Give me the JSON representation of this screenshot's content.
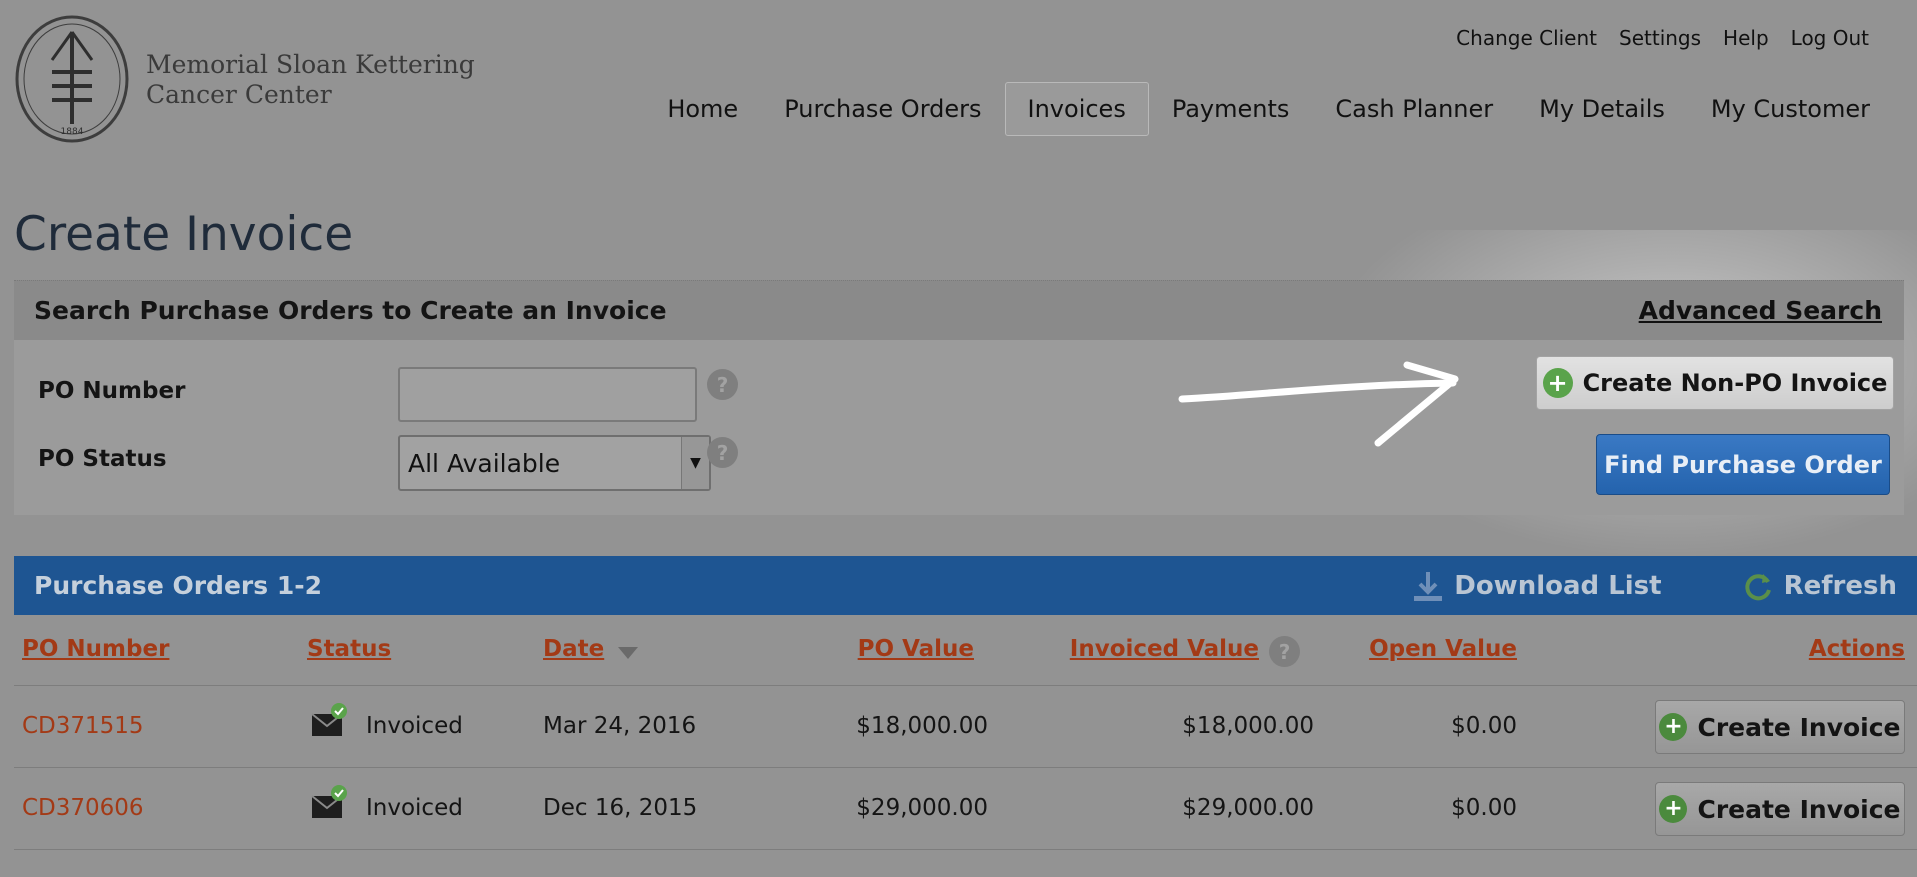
{
  "org": {
    "name_line1": "Memorial Sloan Kettering",
    "name_line2": "Cancer Center",
    "logo_year": "1884"
  },
  "util_nav": [
    "Change Client",
    "Settings",
    "Help",
    "Log Out"
  ],
  "main_nav": {
    "items": [
      "Home",
      "Purchase Orders",
      "Invoices",
      "Payments",
      "Cash Planner",
      "My Details",
      "My Customer"
    ],
    "active": "Invoices"
  },
  "page_title": "Create Invoice",
  "search": {
    "title": "Search Purchase Orders to Create an Invoice",
    "advanced_link": "Advanced Search",
    "po_number_label": "PO Number",
    "po_number_value": "",
    "po_status_label": "PO Status",
    "po_status_selected": "All Available",
    "help_glyph": "?",
    "create_nonpo_label": "Create Non-PO Invoice",
    "find_label": "Find Purchase Order"
  },
  "results": {
    "title": "Purchase Orders 1-2",
    "download_label": "Download List",
    "refresh_label": "Refresh",
    "columns": [
      "PO Number",
      "Status",
      "Date",
      "PO Value",
      "Invoiced Value",
      "Open Value",
      "Actions"
    ],
    "rows": [
      {
        "po_number": "CD371515",
        "status": "Invoiced",
        "date": "Mar 24, 2016",
        "po_value": "$18,000.00",
        "invoiced_value": "$18,000.00",
        "open_value": "$0.00",
        "action": "Create Invoice"
      },
      {
        "po_number": "CD370606",
        "status": "Invoiced",
        "date": "Dec 16, 2015",
        "po_value": "$29,000.00",
        "invoiced_value": "$29,000.00",
        "open_value": "$0.00",
        "action": "Create Invoice"
      }
    ]
  },
  "colors": {
    "accent_blue": "#1e5592",
    "link_red": "#a33a16",
    "plus_green": "#5aa34b"
  },
  "icons": [
    "msk-logo-icon",
    "help-icon",
    "plus-circle-icon",
    "download-icon",
    "refresh-icon",
    "sort-desc-icon",
    "envelope-check-icon",
    "annotation-arrow"
  ]
}
